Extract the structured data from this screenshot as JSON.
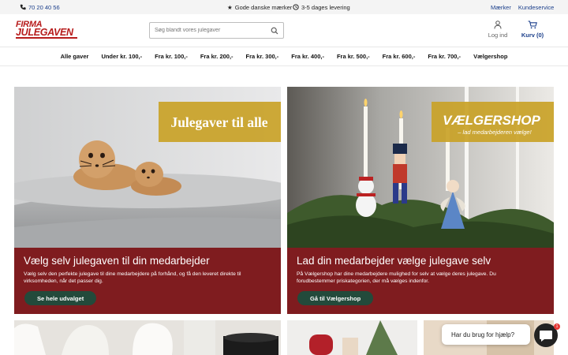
{
  "topbar": {
    "phone": "70 20 40 56",
    "usp1": "Gode danske mærker",
    "usp2": "3-5 dages levering",
    "links": [
      "Mærker",
      "Kundeservice"
    ]
  },
  "header": {
    "logo_line1": "FIRMA",
    "logo_line2": "JULEGAVEN",
    "search_placeholder": "Søg blandt vores julegaver",
    "login_label": "Log ind",
    "cart_label": "Kurv (0)"
  },
  "nav": [
    "Alle gaver",
    "Under kr. 100,-",
    "Fra kr. 100,-",
    "Fra kr. 200,-",
    "Fra kr. 300,-",
    "Fra kr. 400,-",
    "Fra kr. 500,-",
    "Fra kr. 600,-",
    "Fra kr. 700,-",
    "Vælgershop"
  ],
  "cards": [
    {
      "badge": "Julegaver til alle",
      "title": "Vælg selv julegaven til din medarbejder",
      "text": "Vælg selv den perfekte julegave til dine medarbejdere på forhånd, og få den leveret direkte til virksomheden, når det passer dig.",
      "button": "Se hele udvalget"
    },
    {
      "badge": "VÆLGERSHOP",
      "badge_sub": "– lad medarbejderen vælge!",
      "title": "Lad din medarbejder vælge julegave selv",
      "text": "På Vælgershop har dine medarbejdere mulighed for selv at vælge deres julegave. Du forudbestemmer priskategorien, der må vælges indenfor.",
      "button": "Gå til Vælgershop"
    }
  ],
  "chat": {
    "prompt": "Har du brug for hjælp?",
    "badge_count": "1"
  },
  "colors": {
    "brand_red": "#b71c1c",
    "panel_red": "#7f1c1f",
    "button_green": "#234a3b",
    "link_blue": "#1b3f8b",
    "badge_gold": "#c9a227"
  }
}
